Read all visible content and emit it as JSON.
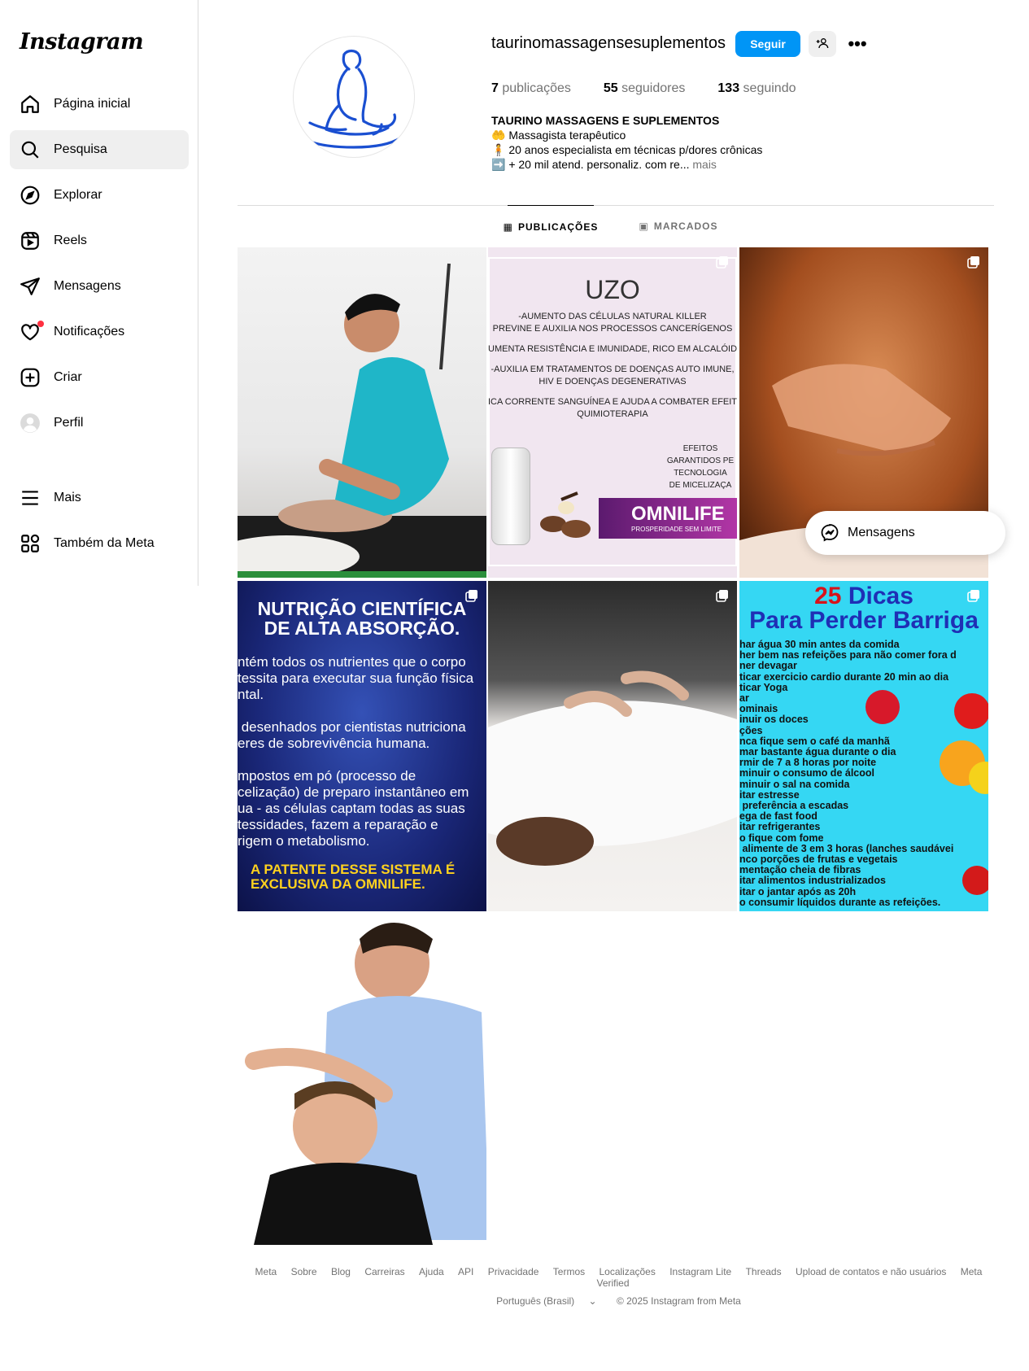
{
  "app": {
    "logo": "Instagram"
  },
  "sidebar": {
    "items": [
      {
        "label": "Página inicial",
        "icon": "home-icon"
      },
      {
        "label": "Pesquisa",
        "icon": "search-icon"
      },
      {
        "label": "Explorar",
        "icon": "compass-icon"
      },
      {
        "label": "Reels",
        "icon": "reels-icon"
      },
      {
        "label": "Mensagens",
        "icon": "send-icon"
      },
      {
        "label": "Notificações",
        "icon": "heart-icon"
      },
      {
        "label": "Criar",
        "icon": "plus-square-icon"
      },
      {
        "label": "Perfil",
        "icon": "avatar-icon"
      }
    ],
    "bottom": [
      {
        "label": "Mais",
        "icon": "menu-icon"
      },
      {
        "label": "Também da Meta",
        "icon": "meta-apps-icon"
      }
    ]
  },
  "profile": {
    "username": "taurinomassagensesuplementos",
    "follow_label": "Seguir",
    "stats": {
      "posts_count": "7",
      "posts_label": "publicações",
      "followers_count": "55",
      "followers_label": "seguidores",
      "following_count": "133",
      "following_label": "seguindo"
    },
    "bio": {
      "name": "TAURINO MASSAGENS E SUPLEMENTOS",
      "line1": "🤲 Massagista terapêutico",
      "line2": "🧍 20 anos especialista em técnicas p/dores crônicas",
      "line3": "➡️ + 20 mil atend. personaliz. com re...",
      "more": "mais"
    }
  },
  "tabs": [
    {
      "label": "PUBLICAÇÕES",
      "icon": "grid-icon"
    },
    {
      "label": "MARCADOS",
      "icon": "tagged-icon"
    }
  ],
  "posts": {
    "uzo": {
      "title": "UZO",
      "lines": [
        "-AUMENTO DAS CÉLULAS NATURAL KILLER\nPREVINE E AUXILIA NOS PROCESSOS CANCERÍGENOS",
        "UMENTA RESISTÊNCIA E IMUNIDADE, RICO EM ALCALÓIDI",
        "-AUXILIA EM TRATAMENTOS DE DOENÇAS AUTO IMUNE,\nHIV E DOENÇAS DEGENERATIVAS",
        "ICA CORRENTE SANGUÍNEA E AJUDA A COMBATER EFEIT\nQUIMIOTERAPIA"
      ],
      "effects": "EFEITOS\nGARANTIDOS PE\nTECNOLOGIA\nDE MICELIZAÇA",
      "brand": "OMNILIFE",
      "brand_tagline": "PROSPERIDADE SEM LIMITE"
    },
    "nutricao": {
      "title": "NUTRIÇÃO CIENTÍFICA\nDE ALTA ABSORÇÃO.",
      "body": "ntém todos os nutrientes que o corpo\ntessita para executar sua função física\nntal.\n\n desenhados por cientistas nutriciona\neres de sobrevivência humana.\n\nmpostos em pó (processo de\ncelização) de preparo instantâneo em\nua - as células captam todas as suas\ntessidades, fazem a reparação e\nrigem o metabolismo.",
      "footer": "A PATENTE DESSE SISTEMA É\nEXCLUSIVA DA OMNILIFE."
    },
    "dicas": {
      "title_number": "25",
      "title_word": "Dicas",
      "subtitle": "Para Perder Barriga",
      "list": "har água 30 min antes da comida\nher bem nas refeições para não comer fora d\nner devagar\nticar exercicio cardio durante 20 min ao dia\nticar Yoga\nar\nominais\ninuir os doces\nções\nnca fique sem o café da manhã\nmar bastante água durante o dia\nrmir de 7 a 8 horas por noite\nminuir o consumo de álcool\nminuir o sal na comida\nitar estresse\n preferência a escadas\nega de fast food\nitar refrigerantes\no fique com fome\n alimente de 3 em 3 horas (lanches saudávei\nnco porções de frutas e vegetais\nmentação cheia de fibras\nitar alimentos industrializados\nitar o jantar após as 20h\no consumir líquidos durante as refeições."
    }
  },
  "messages_pill": {
    "label": "Mensagens"
  },
  "footer": {
    "links": [
      "Meta",
      "Sobre",
      "Blog",
      "Carreiras",
      "Ajuda",
      "API",
      "Privacidade",
      "Termos",
      "Localizações",
      "Instagram Lite",
      "Threads",
      "Upload de contatos e não usuários",
      "Meta Verified"
    ],
    "language": "Português (Brasil)",
    "copyright": "© 2025 Instagram from Meta"
  },
  "colors": {
    "accent": "#0095f6",
    "notification": "#ff3040",
    "muted": "#737373"
  }
}
